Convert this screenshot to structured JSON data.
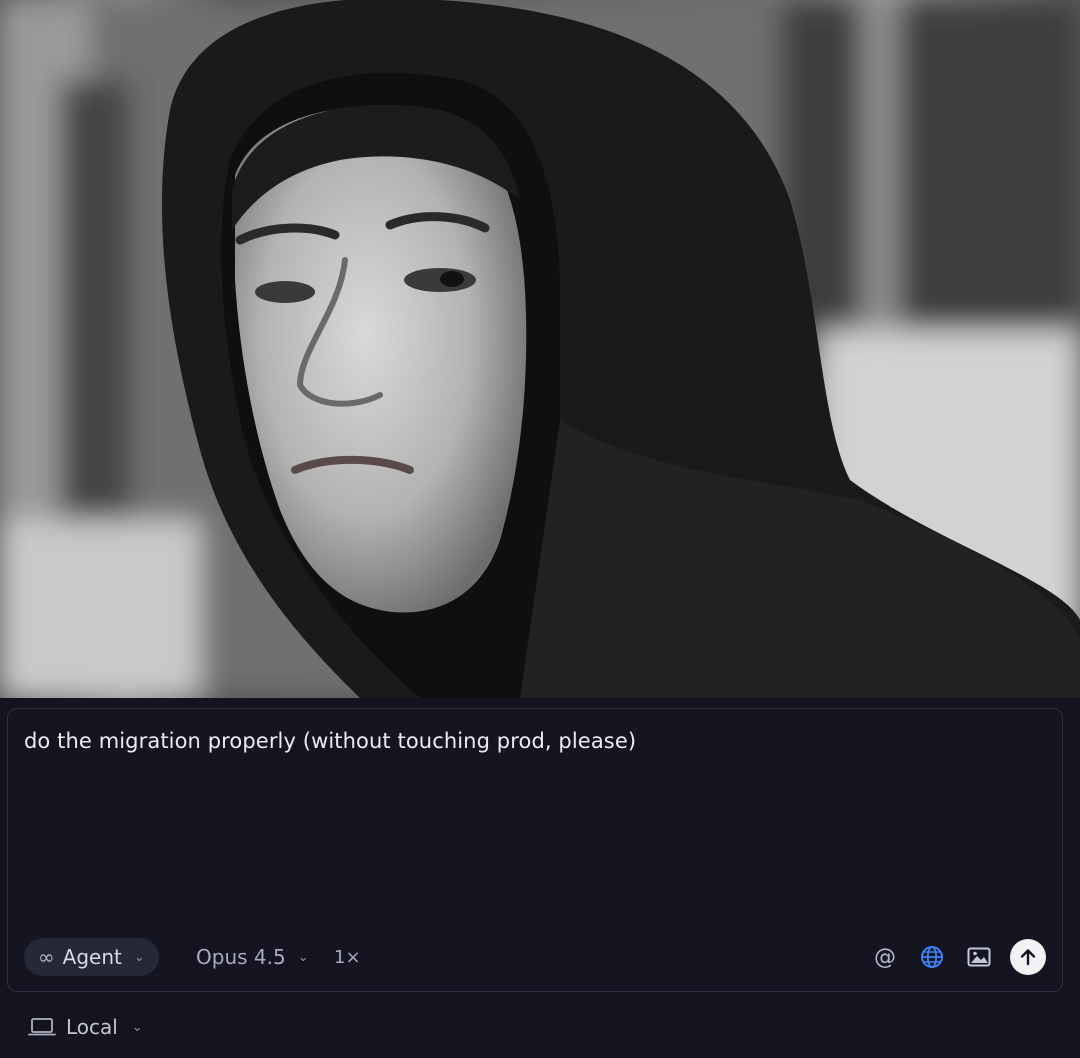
{
  "composer": {
    "prompt_text": "do the migration properly (without touching prod, please)",
    "mode_label": "Agent",
    "model_label": "Opus 4.5",
    "multiplier_label": "1×",
    "icons": [
      "infinity-icon",
      "chevron-down-icon",
      "at-mention-icon",
      "globe-icon",
      "image-icon",
      "send-arrow-icon"
    ],
    "accent_color": "#3b82f6"
  },
  "footer": {
    "environment_label": "Local"
  }
}
